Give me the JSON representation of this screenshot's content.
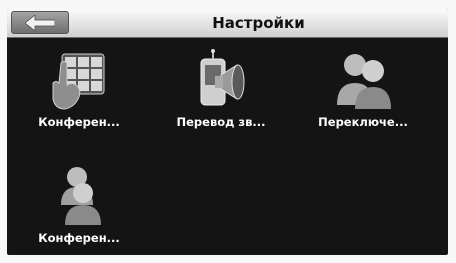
{
  "header": {
    "title": "Настройки"
  },
  "items": [
    {
      "label": "Конферен...",
      "icon": "conference-keypad-icon"
    },
    {
      "label": "Перевод зв...",
      "icon": "call-transfer-icon"
    },
    {
      "label": "Переключе...",
      "icon": "switch-users-icon"
    },
    {
      "label": "Конферен...",
      "icon": "conference-users-icon"
    }
  ]
}
